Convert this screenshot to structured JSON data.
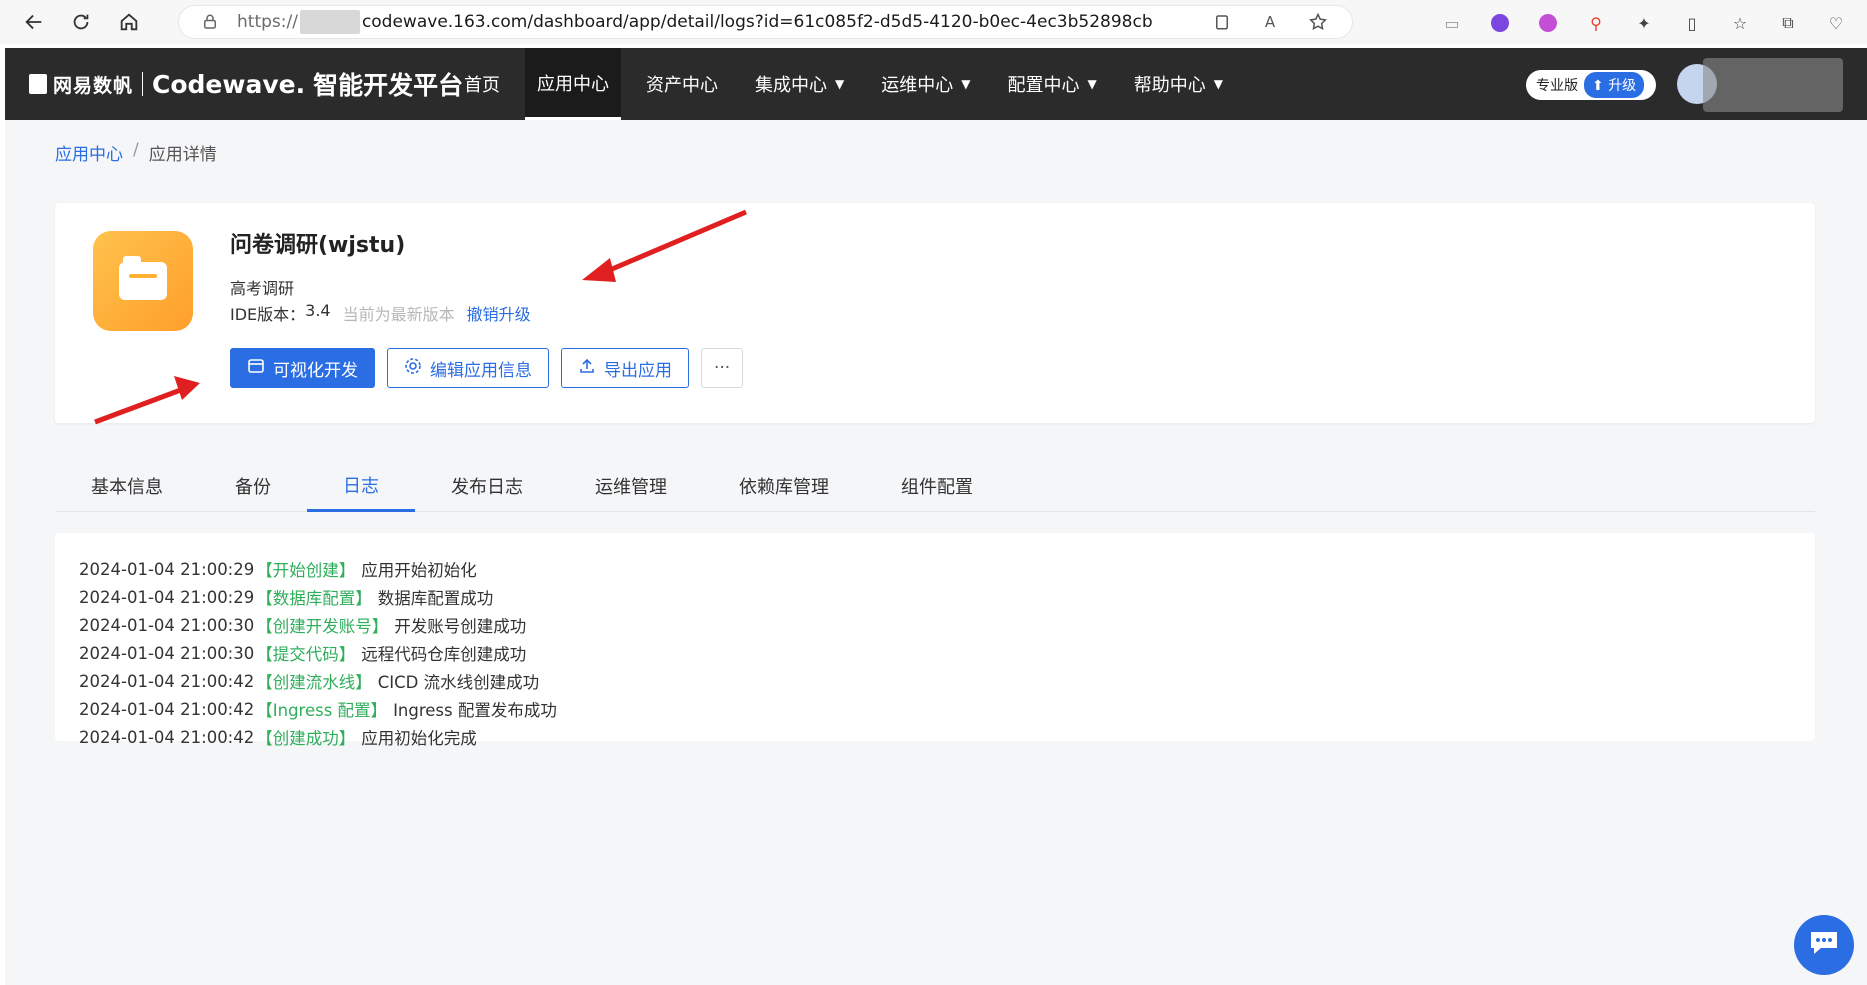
{
  "browser": {
    "url_prefix": "https://",
    "url_rest": "codewave.163.com/dashboard/app/detail/logs?id=61c085f2-d5d5-4120-b0ec-4ec3b52898cb"
  },
  "header": {
    "brand_netease": "网易数帆",
    "brand_codewave": "Codewave.",
    "brand_platform": "智能开发平台",
    "nav": [
      {
        "label": "首页"
      },
      {
        "label": "应用中心"
      },
      {
        "label": "资产中心"
      },
      {
        "label": "集成中心"
      },
      {
        "label": "运维中心"
      },
      {
        "label": "配置中心"
      },
      {
        "label": "帮助中心"
      }
    ],
    "edition_label": "专业版",
    "upgrade_label": "升级"
  },
  "breadcrumb": {
    "parent": "应用中心",
    "separator": "/",
    "current": "应用详情"
  },
  "app": {
    "title": "问卷调研(wjstu)",
    "description": "高考调研",
    "ide_label": "IDE版本：",
    "ide_version": "3.4",
    "version_hint": "当前为最新版本",
    "revert_label": "撤销升级",
    "buttons": {
      "visual_dev": "可视化开发",
      "edit_info": "编辑应用信息",
      "export": "导出应用",
      "more": "···"
    }
  },
  "tabs": [
    {
      "label": "基本信息"
    },
    {
      "label": "备份"
    },
    {
      "label": "日志"
    },
    {
      "label": "发布日志"
    },
    {
      "label": "运维管理"
    },
    {
      "label": "依赖库管理"
    },
    {
      "label": "组件配置"
    }
  ],
  "logs": [
    {
      "time": "2024-01-04 21:00:29",
      "tag": "【开始创建】",
      "message": "应用开始初始化"
    },
    {
      "time": "2024-01-04 21:00:29",
      "tag": "【数据库配置】",
      "message": "数据库配置成功"
    },
    {
      "time": "2024-01-04 21:00:30",
      "tag": "【创建开发账号】",
      "message": "开发账号创建成功"
    },
    {
      "time": "2024-01-04 21:00:30",
      "tag": "【提交代码】",
      "message": "远程代码仓库创建成功"
    },
    {
      "time": "2024-01-04 21:00:42",
      "tag": "【创建流水线】",
      "message": "CICD 流水线创建成功"
    },
    {
      "time": "2024-01-04 21:00:42",
      "tag": "【Ingress 配置】",
      "message": "Ingress 配置发布成功"
    },
    {
      "time": "2024-01-04 21:00:42",
      "tag": "【创建成功】",
      "message": "应用初始化完成"
    }
  ],
  "colors": {
    "accent": "#2b6de3",
    "header_bg": "#2b2b2b",
    "log_tag": "#2fae5b",
    "annotation_arrow": "#e02020"
  }
}
